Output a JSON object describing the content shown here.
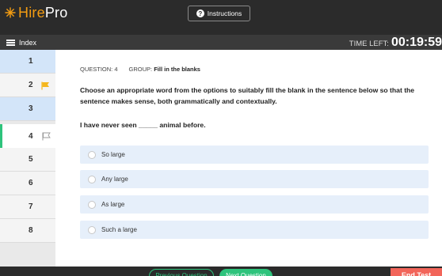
{
  "header": {
    "logo_prefix": "Hire",
    "logo_suffix": "Pro",
    "instructions_label": "Instructions",
    "index_label": "Index",
    "time_left_label": "TIME LEFT:",
    "time_left_value": "00:19:59"
  },
  "sidebar": {
    "items": [
      {
        "number": "1",
        "state": "answered",
        "flag": "none"
      },
      {
        "number": "2",
        "state": "plain",
        "flag": "filled"
      },
      {
        "number": "3",
        "state": "answered",
        "flag": "none"
      },
      {
        "number": "4",
        "state": "current",
        "flag": "outline"
      },
      {
        "number": "5",
        "state": "plain",
        "flag": "none"
      },
      {
        "number": "6",
        "state": "plain",
        "flag": "none"
      },
      {
        "number": "7",
        "state": "plain",
        "flag": "none"
      },
      {
        "number": "8",
        "state": "plain",
        "flag": "none"
      }
    ]
  },
  "question": {
    "number_label": "QUESTION: 4",
    "group_label": "GROUP:",
    "group_value": "Fill in the blanks",
    "prompt": "Choose an appropriate word from the options to suitably fill the blank in the sentence below so that the sentence makes sense, both grammatically and contextually.",
    "sentence": "I have never seen _____ animal before.",
    "options": [
      {
        "label": "So large"
      },
      {
        "label": "Any large"
      },
      {
        "label": "As large"
      },
      {
        "label": "Such a large"
      }
    ]
  },
  "footer": {
    "previous_label": "Previous Question",
    "next_label": "Next Question",
    "end_label": "End Test"
  },
  "colors": {
    "topbar": "#2b2b2b",
    "answered": "#d3e5f9",
    "current_accent": "#2ec37c",
    "flag": "#f5b71f",
    "option_bg": "#e6effa",
    "end_button": "#f2655a"
  }
}
